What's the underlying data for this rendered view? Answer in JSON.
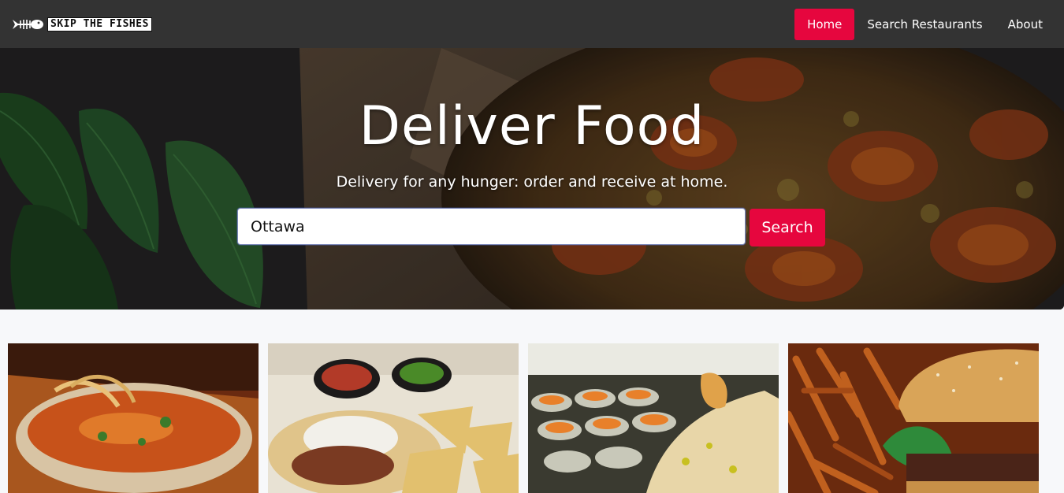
{
  "brand": {
    "name": "SKIP THE FISHES",
    "logo_icon": "fish-skeleton-icon"
  },
  "nav": {
    "items": [
      {
        "label": "Home",
        "active": true
      },
      {
        "label": "Search Restaurants",
        "active": false
      },
      {
        "label": "About",
        "active": false
      }
    ]
  },
  "hero": {
    "title": "Deliver Food",
    "subtitle": "Delivery for any hunger: order and receive at home.",
    "search_value": "Ottawa",
    "search_button": "Search"
  },
  "cards": [
    {
      "image": "curry-soup-bowl-photo"
    },
    {
      "image": "tacos-and-chips-photo"
    },
    {
      "image": "sushi-platter-photo"
    },
    {
      "image": "burger-and-fries-photo"
    }
  ],
  "colors": {
    "accent": "#e6063e",
    "navbar": "#333333",
    "background": "#f7f8fa"
  }
}
